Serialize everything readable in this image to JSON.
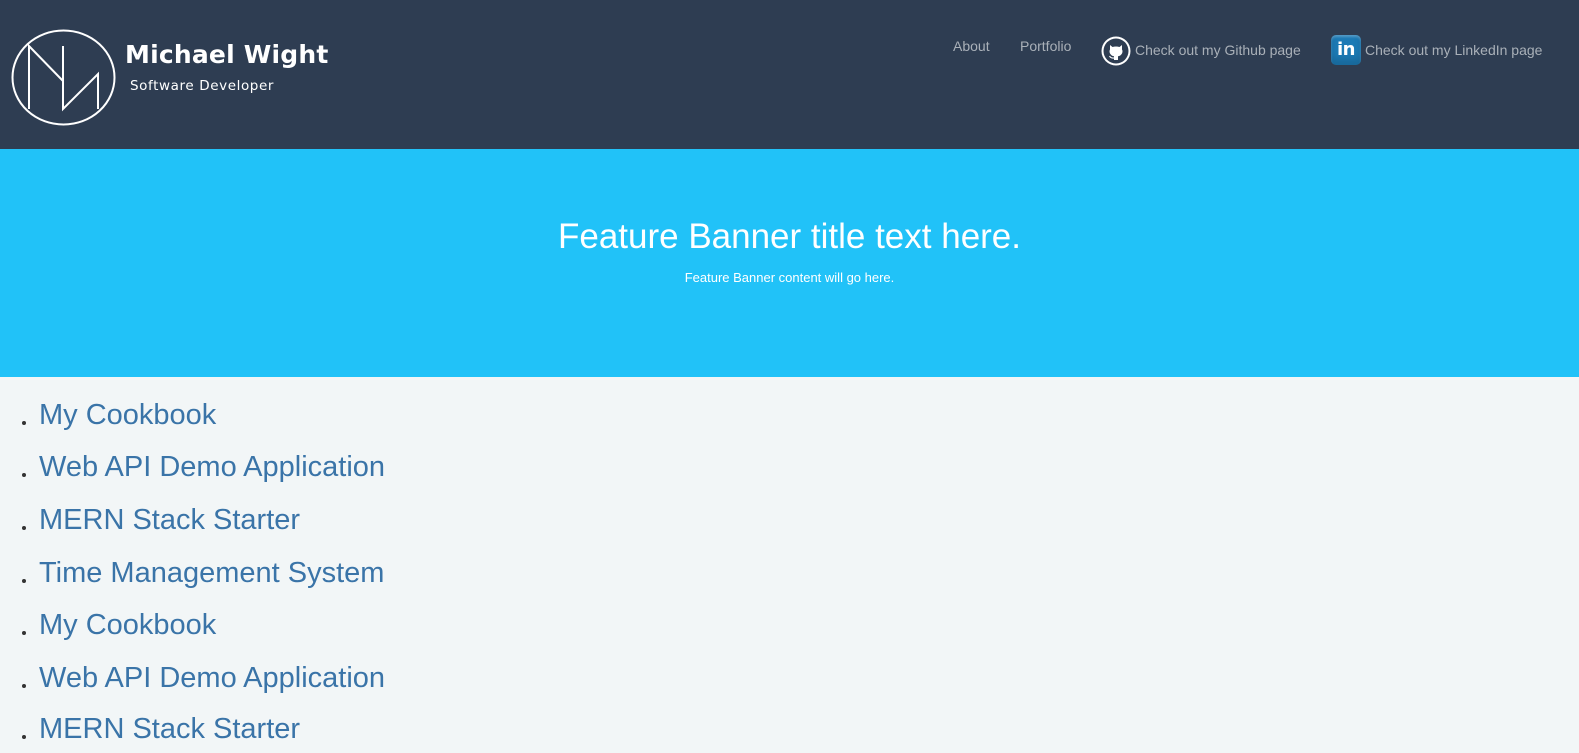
{
  "brand": {
    "name": "Michael Wight",
    "tagline": "Software Developer",
    "logo_icon": "mw-monogram-logo"
  },
  "nav": {
    "about": "About",
    "portfolio": "Portfolio",
    "github": "Check out my Github page",
    "github_icon": "github-octocat-icon",
    "linkedin": "Check out my LinkedIn page",
    "linkedin_icon": "linkedin-icon",
    "linkedin_icon_text": "in"
  },
  "banner": {
    "title": "Feature Banner title text here.",
    "content": "Feature Banner content will go here."
  },
  "projects": [
    "My Cookbook",
    "Web API Demo Application",
    "MERN Stack Starter",
    "Time Management System",
    "My Cookbook",
    "Web API Demo Application",
    "MERN Stack Starter"
  ],
  "colors": {
    "header_bg": "#2e3d52",
    "banner_bg": "#21c2f8",
    "page_bg": "#f2f6f7",
    "link": "#3a74a8",
    "nav_text": "#a9b0b8",
    "linkedin_blue": "#1c7ab5"
  }
}
